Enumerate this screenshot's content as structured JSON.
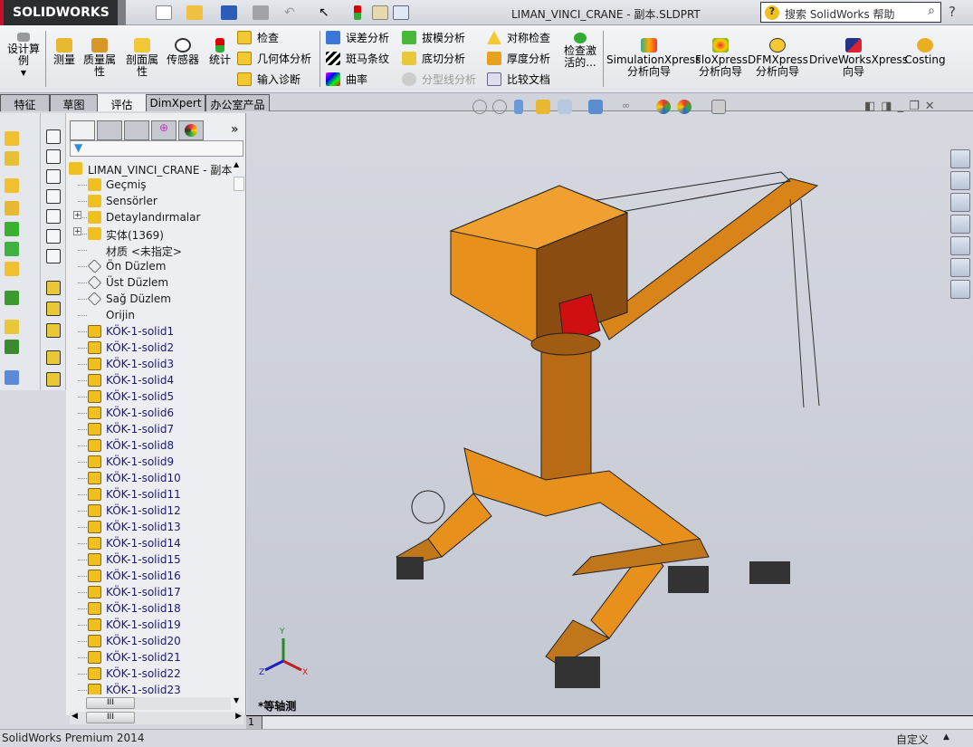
{
  "app": {
    "logo": "SOLIDWORKS",
    "title": "LIMAN_VINCI_CRANE - 副本.SLDPRT",
    "search_placeholder": "搜索 SolidWorks 帮助",
    "help_label": "?"
  },
  "quick_access": [
    "new-icon",
    "open-icon",
    "save-icon",
    "print-icon",
    "undo-icon",
    "select-icon",
    "rebuild-icon",
    "file-properties-icon",
    "options-icon"
  ],
  "ribbon": {
    "design_study": "设计算例",
    "large": [
      {
        "label": "测量",
        "icon": "measure-icon"
      },
      {
        "label": "质量属性",
        "icon": "mass-properties-icon"
      },
      {
        "label": "剖面属性",
        "icon": "section-properties-icon"
      },
      {
        "label": "传感器",
        "icon": "sensor-icon"
      },
      {
        "label": "统计",
        "icon": "statistics-icon"
      }
    ],
    "col1": [
      "检查",
      "几何体分析",
      "输入诊断"
    ],
    "col2": [
      "误差分析",
      "斑马条纹",
      "曲率"
    ],
    "col3": [
      "拔模分析",
      "底切分析",
      "分型线分析"
    ],
    "col4": [
      "对称检查",
      "厚度分析",
      "比较文档"
    ],
    "check_active": "检查激活的...",
    "xpress": [
      {
        "line1": "SimulationXpress",
        "line2": "分析向导"
      },
      {
        "line1": "FloXpress",
        "line2": "分析向导"
      },
      {
        "line1": "DFMXpress",
        "line2": "分析向导"
      },
      {
        "line1": "DriveWorksXpress",
        "line2": "向导"
      },
      {
        "line1": "Costing",
        "line2": ""
      }
    ]
  },
  "tabs": [
    {
      "label": "特征"
    },
    {
      "label": "草图"
    },
    {
      "label": "评估",
      "active": true
    },
    {
      "label": "DimXpert"
    },
    {
      "label": "办公室产品"
    }
  ],
  "tree": {
    "root": "LIMAN_VINCI_CRANE - 副本",
    "expand_label": "»",
    "items": [
      {
        "label": "Geçmiş",
        "icon": "history-icon"
      },
      {
        "label": "Sensörler",
        "icon": "sensors-folder-icon"
      },
      {
        "label": "Detaylandırmalar",
        "icon": "annotations-icon",
        "expandable": true
      },
      {
        "label": "实体(1369)",
        "icon": "solid-bodies-folder-icon",
        "expandable": true
      },
      {
        "label": "材质 <未指定>",
        "icon": "material-icon"
      },
      {
        "label": "Ön Düzlem",
        "icon": "plane-icon"
      },
      {
        "label": "Üst Düzlem",
        "icon": "plane-icon"
      },
      {
        "label": "Sağ Düzlem",
        "icon": "plane-icon"
      },
      {
        "label": "Orijin",
        "icon": "origin-icon"
      },
      {
        "label": "KÖK-1-solid1",
        "icon": "solid-body-icon"
      },
      {
        "label": "KÖK-1-solid2",
        "icon": "solid-body-icon"
      },
      {
        "label": "KÖK-1-solid3",
        "icon": "solid-body-icon"
      },
      {
        "label": "KÖK-1-solid4",
        "icon": "solid-body-icon"
      },
      {
        "label": "KÖK-1-solid5",
        "icon": "solid-body-icon"
      },
      {
        "label": "KÖK-1-solid6",
        "icon": "solid-body-icon"
      },
      {
        "label": "KÖK-1-solid7",
        "icon": "solid-body-icon"
      },
      {
        "label": "KÖK-1-solid8",
        "icon": "solid-body-icon"
      },
      {
        "label": "KÖK-1-solid9",
        "icon": "solid-body-icon"
      },
      {
        "label": "KÖK-1-solid10",
        "icon": "solid-body-icon"
      },
      {
        "label": "KÖK-1-solid11",
        "icon": "solid-body-icon"
      },
      {
        "label": "KÖK-1-solid12",
        "icon": "solid-body-icon"
      },
      {
        "label": "KÖK-1-solid13",
        "icon": "solid-body-icon"
      },
      {
        "label": "KÖK-1-solid14",
        "icon": "solid-body-icon"
      },
      {
        "label": "KÖK-1-solid15",
        "icon": "solid-body-icon"
      },
      {
        "label": "KÖK-1-solid16",
        "icon": "solid-body-icon"
      },
      {
        "label": "KÖK-1-solid17",
        "icon": "solid-body-icon"
      },
      {
        "label": "KÖK-1-solid18",
        "icon": "solid-body-icon"
      },
      {
        "label": "KÖK-1-solid19",
        "icon": "solid-body-icon"
      },
      {
        "label": "KÖK-1-solid20",
        "icon": "solid-body-icon"
      },
      {
        "label": "KÖK-1-solid21",
        "icon": "solid-body-icon"
      },
      {
        "label": "KÖK-1-solid22",
        "icon": "solid-body-icon"
      },
      {
        "label": "KÖK-1-solid23",
        "icon": "solid-body-icon"
      }
    ],
    "scroll_grip": "III"
  },
  "viewport": {
    "view_name": "*等轴测",
    "axis": {
      "x": "X",
      "y": "Y",
      "z": "Z"
    },
    "model_color": "#e8901c"
  },
  "sheet_tab": "1",
  "status": {
    "product": "SolidWorks Premium 2014",
    "custom": "自定义"
  }
}
